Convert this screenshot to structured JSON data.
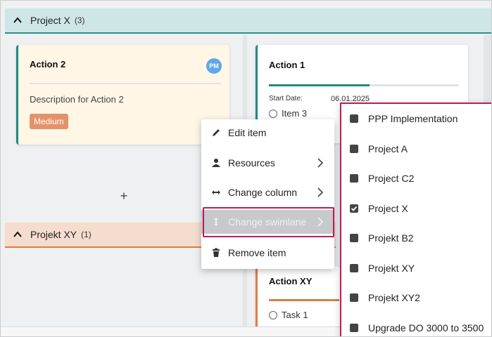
{
  "board": {
    "lanes": [
      {
        "name": "Project X",
        "count": "(3)"
      },
      {
        "name": "Projekt XY",
        "count": "(1)"
      }
    ],
    "add_label": "+"
  },
  "cards": {
    "action2": {
      "title": "Action 2",
      "avatar": "PM",
      "description": "Description for Action 2",
      "priority": "Medium"
    },
    "action1": {
      "title": "Action 1",
      "start_label": "Start Date:",
      "start_value": "06.01.2025",
      "progress": 0.53,
      "items": [
        "Item 3"
      ]
    },
    "actionxy": {
      "title": "Action XY",
      "tasks": [
        "Task 1"
      ]
    }
  },
  "context_menu": {
    "items": [
      {
        "label": "Edit item",
        "icon": "pencil-icon"
      },
      {
        "label": "Resources",
        "icon": "person-icon"
      },
      {
        "label": "Change column",
        "icon": "horizontal-arrows-icon"
      },
      {
        "label": "Change swimlane",
        "icon": "vertical-arrows-icon"
      },
      {
        "label": "Remove item",
        "icon": "trash-icon"
      }
    ]
  },
  "swimlane_submenu": {
    "options": [
      {
        "label": "PPP Implementation",
        "checked": false
      },
      {
        "label": "Project A",
        "checked": false
      },
      {
        "label": "Project C2",
        "checked": false
      },
      {
        "label": "Project X",
        "checked": true
      },
      {
        "label": "Projekt B2",
        "checked": false
      },
      {
        "label": "Projekt XY",
        "checked": false
      },
      {
        "label": "Projekt XY2",
        "checked": false
      },
      {
        "label": "Upgrade DO 3000 to 3500",
        "checked": false
      }
    ]
  },
  "colors": {
    "teal": "#1e8a82",
    "orange": "#e07a4a",
    "highlight": "#c2185b",
    "avatar": "#5fa7e8",
    "badge": "#e3936b"
  }
}
